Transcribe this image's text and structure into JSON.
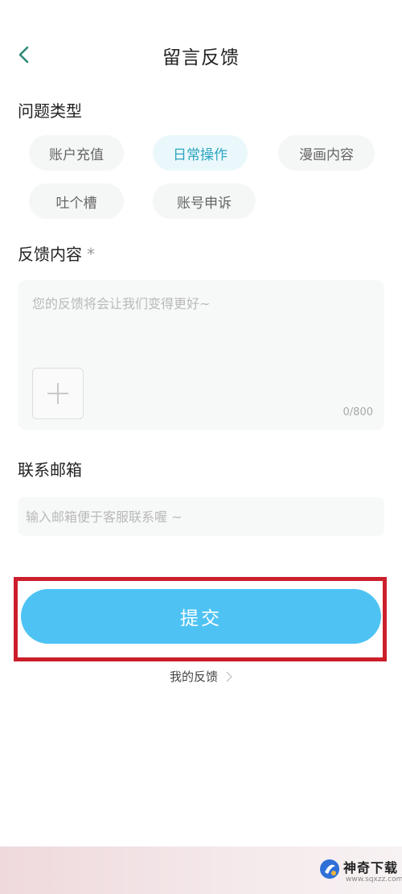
{
  "header": {
    "title": "留言反馈",
    "back_icon": "chevron-left-icon"
  },
  "issue_type": {
    "label": "问题类型",
    "options": [
      "账户充值",
      "日常操作",
      "漫画内容",
      "吐个槽",
      "账号申诉"
    ],
    "selected": "日常操作"
  },
  "feedback": {
    "label": "反馈内容",
    "required_mark": "*",
    "placeholder": "您的反馈将会让我们变得更好~",
    "counter": "0/800"
  },
  "contact": {
    "label": "联系邮箱",
    "placeholder": "输入邮箱便于客服联系喔 ~"
  },
  "submit_label": "提交",
  "my_feedback_label": "我的反馈",
  "watermark": {
    "name": "神奇下载",
    "url": "www.sqxzz.com"
  },
  "colors": {
    "accent": "#4ec3f3",
    "selected_chip_text": "#2fa4c1",
    "back_arrow": "#2c8a74",
    "highlight_border": "#cc1e2b"
  }
}
